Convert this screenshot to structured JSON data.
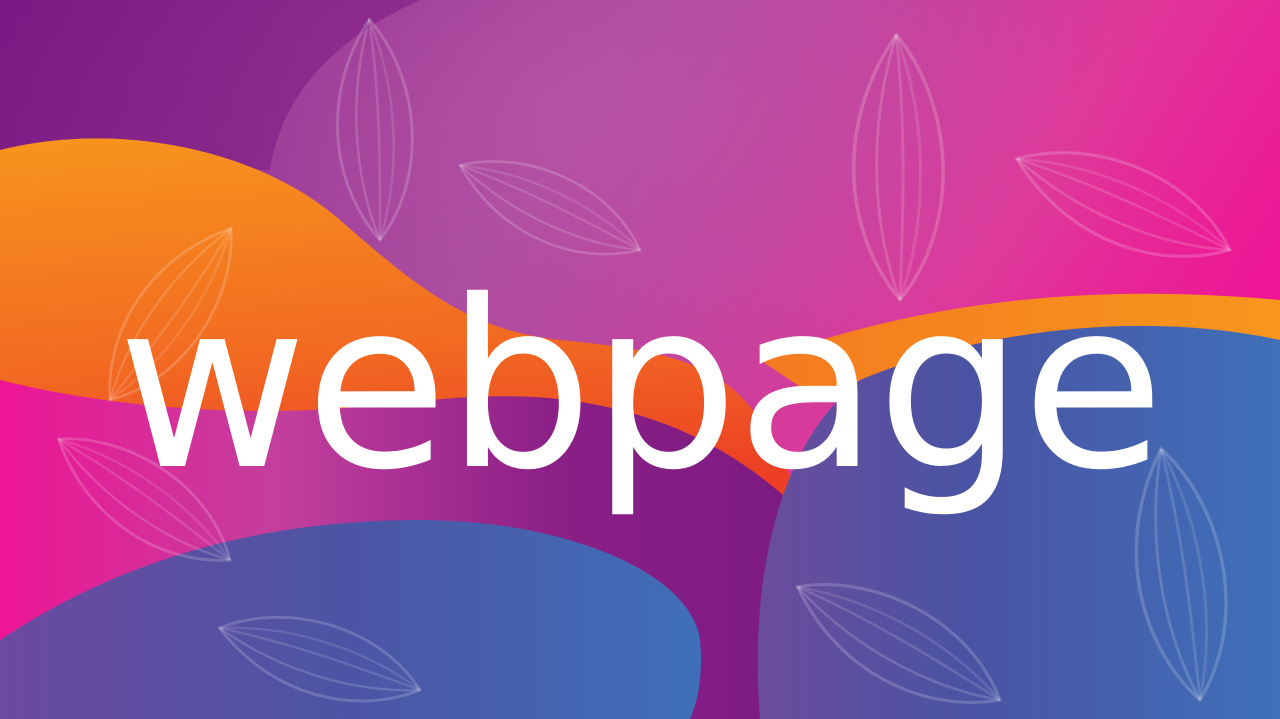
{
  "headline": {
    "text": "webpage"
  },
  "colors": {
    "background_purple": "#7a1a86",
    "background_pink": "#ee1695",
    "orange": "#f7941d",
    "orange_red": "#ef4a24",
    "blue": "#3e6fb7",
    "blue_violet": "#5a4ea0",
    "text": "#ffffff"
  },
  "decor": {
    "pattern": "leaf-outline-icon",
    "shapes": [
      "orange-wave",
      "blue-blob-left",
      "blue-blob-right"
    ]
  }
}
